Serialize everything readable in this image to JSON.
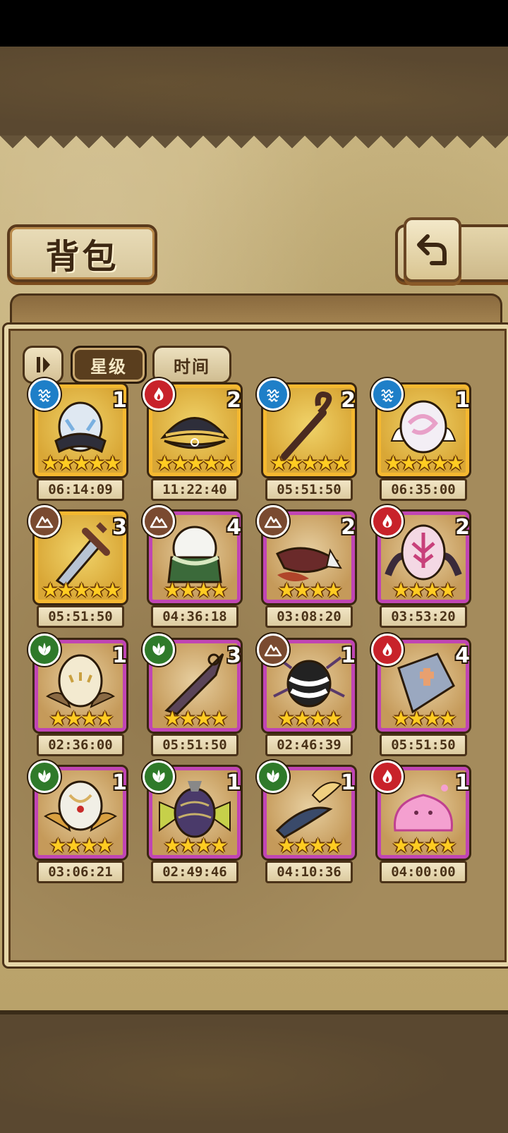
{
  "header": {
    "title": "背包"
  },
  "sort_tabs": {
    "star_label": "星级",
    "time_label": "时间",
    "active": "星级"
  },
  "items": [
    {
      "element": "water",
      "count": "1",
      "stars": "★★★★★",
      "time": "06:14:09",
      "frame": "gold"
    },
    {
      "element": "fire",
      "count": "2",
      "stars": "★★★★★",
      "time": "11:22:40",
      "frame": "gold"
    },
    {
      "element": "water",
      "count": "2",
      "stars": "★★★★★",
      "time": "05:51:50",
      "frame": "gold"
    },
    {
      "element": "water",
      "count": "1",
      "stars": "★★★★★",
      "time": "06:35:00",
      "frame": "gold"
    },
    {
      "element": "earth",
      "count": "3",
      "stars": "★★★★★",
      "time": "05:51:50",
      "frame": "gold"
    },
    {
      "element": "earth",
      "count": "4",
      "stars": "★★★★",
      "time": "04:36:18",
      "frame": "purple"
    },
    {
      "element": "earth",
      "count": "2",
      "stars": "★★★★",
      "time": "03:08:20",
      "frame": "purple"
    },
    {
      "element": "fire",
      "count": "2",
      "stars": "★★★★",
      "time": "03:53:20",
      "frame": "purple"
    },
    {
      "element": "nature",
      "count": "1",
      "stars": "★★★★",
      "time": "02:36:00",
      "frame": "purple"
    },
    {
      "element": "nature",
      "count": "3",
      "stars": "★★★★",
      "time": "05:51:50",
      "frame": "purple"
    },
    {
      "element": "earth",
      "count": "1",
      "stars": "★★★★",
      "time": "02:46:39",
      "frame": "purple"
    },
    {
      "element": "fire",
      "count": "4",
      "stars": "★★★★",
      "time": "05:51:50",
      "frame": "purple"
    },
    {
      "element": "nature",
      "count": "1",
      "stars": "★★★★",
      "time": "03:06:21",
      "frame": "purple"
    },
    {
      "element": "nature",
      "count": "1",
      "stars": "★★★★",
      "time": "02:49:46",
      "frame": "purple"
    },
    {
      "element": "nature",
      "count": "1",
      "stars": "★★★★",
      "time": "04:10:36",
      "frame": "purple"
    },
    {
      "element": "fire",
      "count": "1",
      "stars": "★★★★",
      "time": "04:00:00",
      "frame": "purple"
    }
  ],
  "item_art": [
    "water-egg",
    "pirate-hat",
    "twisted-staff",
    "swirl-egg",
    "broken-sword",
    "leaf-egg",
    "horn",
    "bat-wing-egg",
    "feather-egg",
    "kunai",
    "striped-spider-egg",
    "cracked-shield",
    "bird-egg",
    "butterfly-egg",
    "feather-dagger",
    "pink-slime"
  ],
  "colors": {
    "gold_frame": "#f5b830",
    "purple_frame": "#c045b4",
    "water": "#1e7fc8",
    "fire": "#c8222a",
    "earth": "#7a4a30",
    "nature": "#2f7a2a"
  }
}
